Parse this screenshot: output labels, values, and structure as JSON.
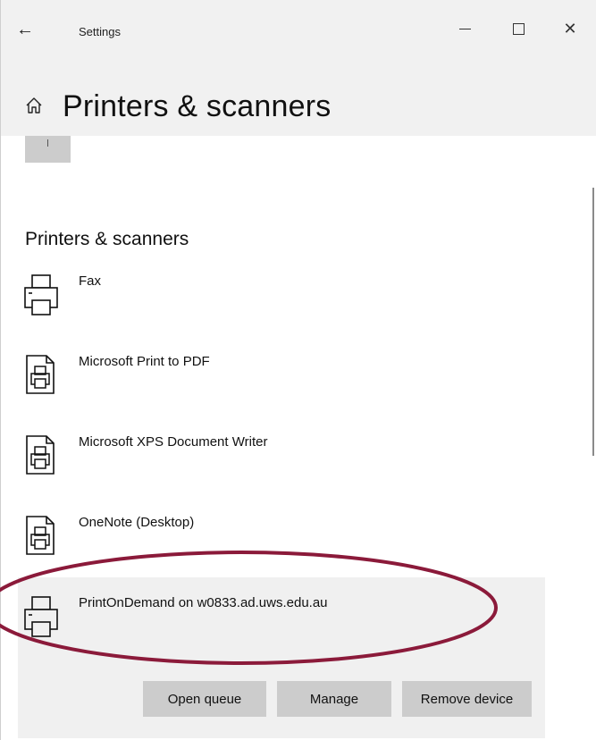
{
  "window": {
    "title": "Settings",
    "back_icon": "←",
    "close_icon": "✕"
  },
  "page": {
    "title": "Printers & scanners",
    "home_icon": "home-icon"
  },
  "section": {
    "heading": "Printers & scanners"
  },
  "printers": [
    {
      "label": "Fax",
      "icon": "fax-printer-icon"
    },
    {
      "label": "Microsoft Print to PDF",
      "icon": "document-printer-icon"
    },
    {
      "label": "Microsoft XPS Document Writer",
      "icon": "document-printer-icon"
    },
    {
      "label": "OneNote (Desktop)",
      "icon": "document-printer-icon"
    },
    {
      "label": "PrintOnDemand on w0833.ad.uws.edu.au",
      "icon": "network-printer-icon",
      "selected": true
    }
  ],
  "actions": {
    "open_queue": "Open queue",
    "manage": "Manage",
    "remove_device": "Remove device"
  },
  "colors": {
    "header_bg": "#f1f1f1",
    "selected_bg": "#f0f0f0",
    "button_bg": "#cccccc",
    "annotation_ring": "#8b1a3a"
  }
}
